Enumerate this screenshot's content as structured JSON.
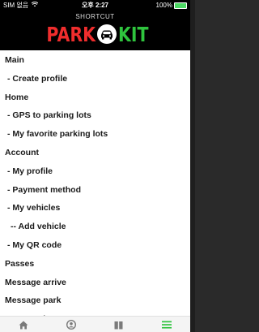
{
  "status_bar": {
    "carrier": "SIM 없음",
    "wifi_icon": "wifi-icon",
    "time": "오후 2:27",
    "battery_percent": "100%"
  },
  "header": {
    "subtitle": "SHORTCUT",
    "logo_part1": "PARK",
    "logo_part2": "KIT",
    "logo_icon": "car-icon"
  },
  "menu": {
    "items": [
      {
        "label": "Main",
        "level": 0
      },
      {
        "label": "- Create profile",
        "level": 1
      },
      {
        "label": "Home",
        "level": 0
      },
      {
        "label": "- GPS to parking lots",
        "level": 1
      },
      {
        "label": "- My favorite parking lots",
        "level": 1
      },
      {
        "label": "Account",
        "level": 0
      },
      {
        "label": "- My profile",
        "level": 1
      },
      {
        "label": "- Payment method",
        "level": 1
      },
      {
        "label": "- My vehicles",
        "level": 1
      },
      {
        "label": "-- Add vehicle",
        "level": 2
      },
      {
        "label": "- My QR code",
        "level": 1
      },
      {
        "label": "Passes",
        "level": 0
      },
      {
        "label": "Message arrive",
        "level": 0
      },
      {
        "label": "Message park",
        "level": 0
      },
      {
        "label": "Message leave",
        "level": 0
      }
    ]
  },
  "tabbar": {
    "tabs": [
      {
        "icon": "home-icon",
        "active": false
      },
      {
        "icon": "user-icon",
        "active": false
      },
      {
        "icon": "book-icon",
        "active": false
      },
      {
        "icon": "menu-icon",
        "active": true
      }
    ],
    "active_color": "#2fc43e",
    "inactive_color": "#7a7a7a"
  },
  "colors": {
    "logo_red": "#ef2d2d",
    "logo_green": "#2fc43e",
    "header_bg": "#000000"
  }
}
